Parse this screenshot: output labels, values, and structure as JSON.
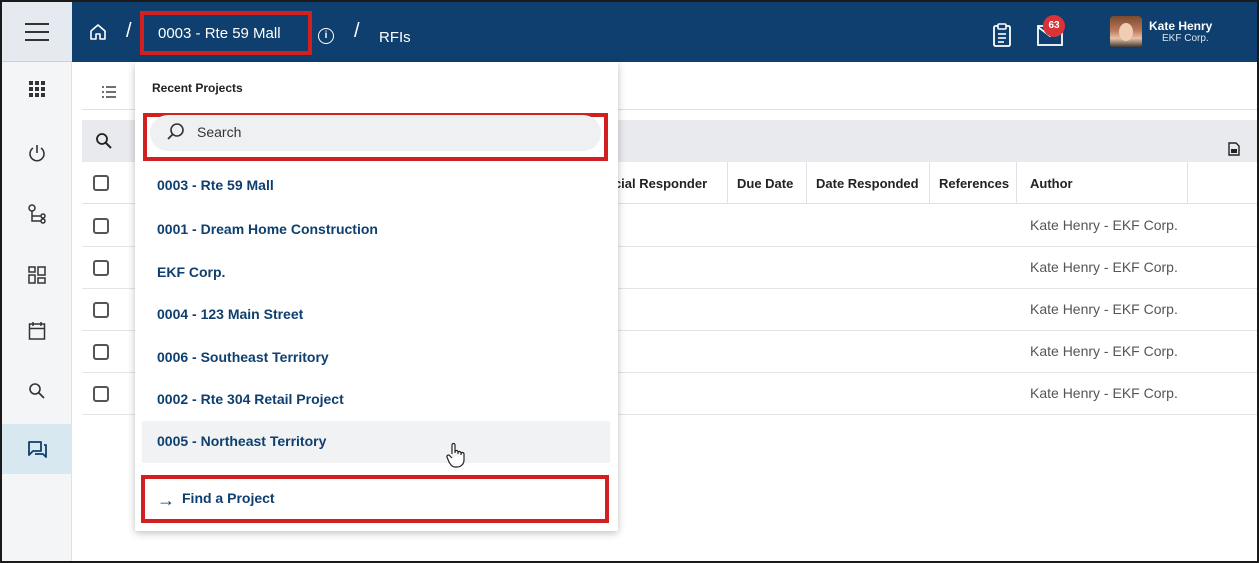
{
  "header": {
    "project_breadcrumb": "0003 - Rte 59 Mall",
    "page_breadcrumb": "RFIs",
    "separator": "/",
    "notification_count": "63",
    "user_name": "Kate Henry",
    "user_org": "EKF Corp."
  },
  "dropdown": {
    "title": "Recent Projects",
    "search_placeholder": "Search",
    "projects": [
      {
        "label": "0003 - Rte 59 Mall"
      },
      {
        "label": "0001 - Dream Home Construction"
      },
      {
        "label": "EKF Corp."
      },
      {
        "label": "0004 - 123 Main Street"
      },
      {
        "label": "0006 - Southeast Territory"
      },
      {
        "label": "0002 - Rte 304 Retail Project"
      },
      {
        "label": "0005 - Northeast Territory"
      }
    ],
    "find_project_label": "Find a Project"
  },
  "table": {
    "columns": [
      {
        "label": "ficial Responder"
      },
      {
        "label": "Due Date"
      },
      {
        "label": "Date Responded"
      },
      {
        "label": "References"
      },
      {
        "label": "Author"
      }
    ],
    "rows": [
      {
        "author": "Kate Henry - EKF Corp."
      },
      {
        "author": "Kate Henry - EKF Corp."
      },
      {
        "author": "Kate Henry - EKF Corp."
      },
      {
        "author": "Kate Henry - EKF Corp."
      },
      {
        "author": "Kate Henry - EKF Corp."
      }
    ]
  },
  "colors": {
    "topbar": "#0e3f6e",
    "highlight": "#d21f1f",
    "badge": "#d9333a",
    "link": "#0e3f6e"
  },
  "icons": [
    "menu-icon",
    "home-icon",
    "info-icon",
    "clipboard-icon",
    "mail-icon",
    "apps-icon",
    "power-icon",
    "workflow-icon",
    "dashboard-icon",
    "calendar-icon",
    "search-icon",
    "rfi-icon",
    "list-icon",
    "export-icon",
    "hand-cursor-icon",
    "arrow-right-icon"
  ]
}
